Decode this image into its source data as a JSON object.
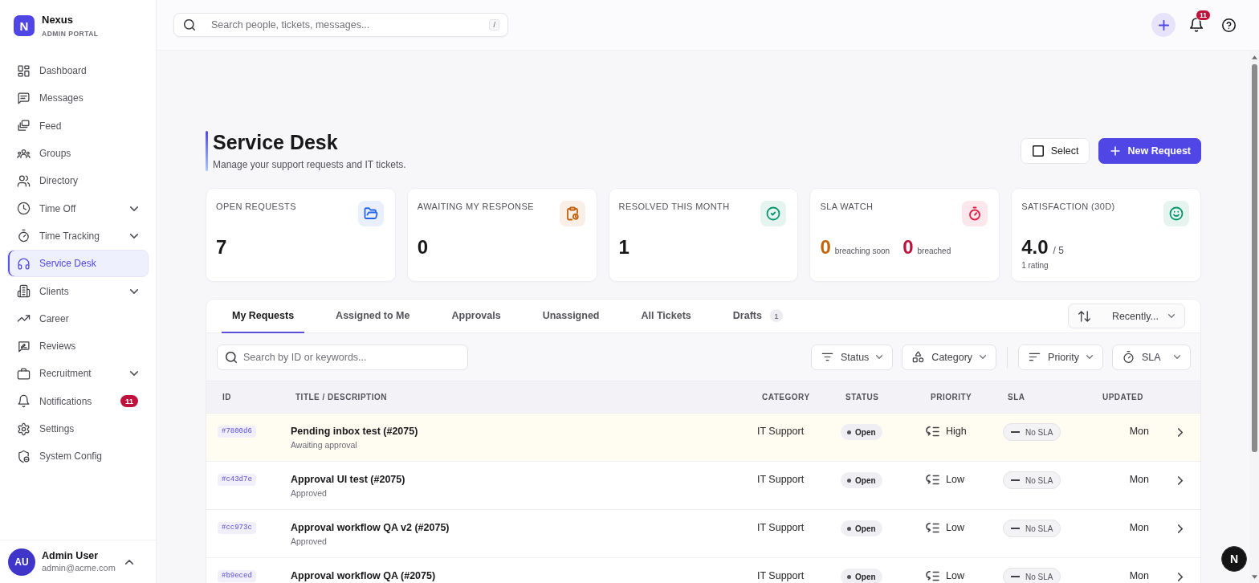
{
  "brand": {
    "logo_letter": "N",
    "name": "Nexus",
    "subtitle": "ADMIN PORTAL"
  },
  "sidebar": {
    "items": [
      {
        "label": "Dashboard",
        "selected": false,
        "expandable": false
      },
      {
        "label": "Messages",
        "selected": false,
        "expandable": false
      },
      {
        "label": "Feed",
        "selected": false,
        "expandable": false
      },
      {
        "label": "Groups",
        "selected": false,
        "expandable": false
      },
      {
        "label": "Directory",
        "selected": false,
        "expandable": false
      },
      {
        "label": "Time Off",
        "selected": false,
        "expandable": true
      },
      {
        "label": "Time Tracking",
        "selected": false,
        "expandable": true
      },
      {
        "label": "Service Desk",
        "selected": true,
        "expandable": false
      },
      {
        "label": "Clients",
        "selected": false,
        "expandable": true
      },
      {
        "label": "Career",
        "selected": false,
        "expandable": false
      },
      {
        "label": "Reviews",
        "selected": false,
        "expandable": false
      },
      {
        "label": "Recruitment",
        "selected": false,
        "expandable": true
      },
      {
        "label": "Notifications",
        "selected": false,
        "expandable": false,
        "badge": "11"
      },
      {
        "label": "Settings",
        "selected": false,
        "expandable": false
      },
      {
        "label": "System Config",
        "selected": false,
        "expandable": false
      }
    ]
  },
  "user": {
    "initials": "AU",
    "name": "Admin User",
    "email": "admin@acme.com"
  },
  "topbar": {
    "search": {
      "placeholder": "Search people, tickets, messages...",
      "shortcut": "/"
    },
    "notification_count": "11"
  },
  "page": {
    "title": "Service Desk",
    "subtitle": "Manage your support requests and IT tickets.",
    "actions": [
      {
        "label": "Select",
        "kind": "secondary"
      },
      {
        "label": "New Request",
        "kind": "primary"
      }
    ]
  },
  "stats": [
    {
      "kind": "value",
      "label": "OPEN REQUESTS",
      "value": "7"
    },
    {
      "kind": "value",
      "label": "AWAITING MY RESPONSE",
      "value": "0"
    },
    {
      "kind": "value",
      "label": "RESOLVED THIS MONTH",
      "value": "1"
    },
    {
      "kind": "split",
      "label": "SLA WATCH",
      "parts": [
        {
          "count": "0",
          "caption": "breaching soon",
          "color": "#c2650a"
        },
        {
          "count": "0",
          "caption": "breached",
          "color": "#be123c"
        }
      ]
    },
    {
      "kind": "rating",
      "label": "SATISFACTION (30D)",
      "value": "4.0",
      "suffix": "/ 5",
      "note": "1 rating"
    }
  ],
  "tabs": [
    {
      "label": "My Requests",
      "selected": true
    },
    {
      "label": "Assigned to Me",
      "selected": false
    },
    {
      "label": "Approvals",
      "selected": false
    },
    {
      "label": "Unassigned",
      "selected": false
    },
    {
      "label": "All Tickets",
      "selected": false
    },
    {
      "label": "Drafts",
      "selected": false,
      "count": "1"
    }
  ],
  "sort": {
    "label": "Recently..."
  },
  "search": {
    "placeholder": "Search by ID or keywords..."
  },
  "filter_groups": [
    [
      {
        "label": "Status"
      },
      {
        "label": "Category"
      }
    ],
    [
      {
        "label": "Priority"
      },
      {
        "label": "SLA"
      }
    ]
  ],
  "table": {
    "columns": [
      "ID",
      "TITLE / DESCRIPTION",
      "CATEGORY",
      "STATUS",
      "PRIORITY",
      "SLA",
      "UPDATED"
    ],
    "rows": [
      {
        "id": "#7800d6",
        "title": "Pending inbox test (#2075)",
        "description": "Awaiting approval",
        "category": "IT Support",
        "status": "Open",
        "priority": "High",
        "sla": "No SLA",
        "updated": "Mon",
        "highlighted": true
      },
      {
        "id": "#c43d7e",
        "title": "Approval UI test (#2075)",
        "description": "Approved",
        "category": "IT Support",
        "status": "Open",
        "priority": "Low",
        "sla": "No SLA",
        "updated": "Mon",
        "highlighted": false
      },
      {
        "id": "#cc973c",
        "title": "Approval workflow QA v2 (#2075)",
        "description": "Approved",
        "category": "IT Support",
        "status": "Open",
        "priority": "Low",
        "sla": "No SLA",
        "updated": "Mon",
        "highlighted": false
      },
      {
        "id": "#b9eced",
        "title": "Approval workflow QA (#2075)",
        "category": "IT Support",
        "status": "Open",
        "priority": "Low",
        "sla": "No SLA",
        "updated": "Mon",
        "highlighted": false
      }
    ]
  },
  "dev_badge": "N"
}
